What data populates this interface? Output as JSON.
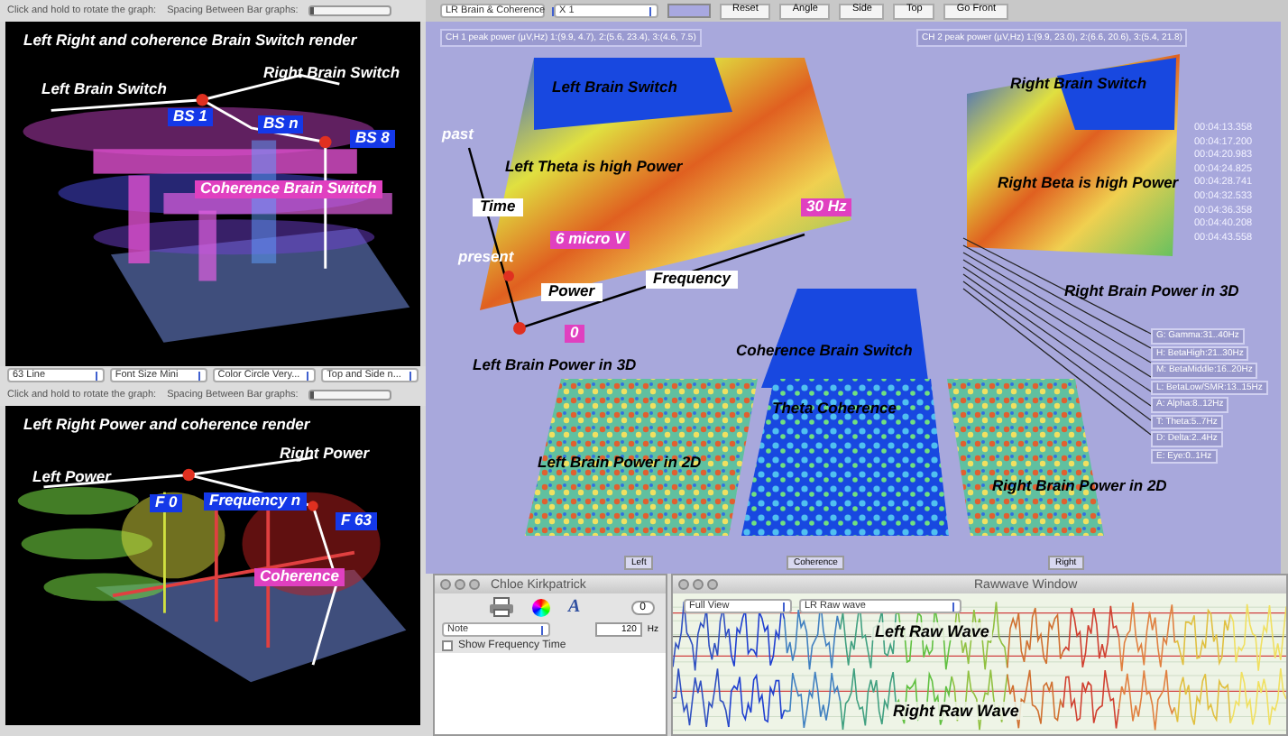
{
  "left_panels": [
    {
      "hint": "Click and hold to rotate the graph:",
      "spacing_label": "Spacing Between Bar graphs:",
      "spacing": {
        "level": 0.04
      },
      "title": "Left Right and coherence Brain Switch render",
      "annotations": [
        {
          "text": "Left Brain Switch",
          "kind": "caption"
        },
        {
          "text": "Right Brain Switch",
          "kind": "caption"
        },
        {
          "text": "BS 1",
          "kind": "tag"
        },
        {
          "text": "BS n",
          "kind": "tag"
        },
        {
          "text": "BS 8",
          "kind": "tag"
        },
        {
          "text": "Coherence Brain Switch",
          "kind": "pink"
        }
      ],
      "selects": [
        "63 Line",
        "Font Size Mini",
        "Color Circle Very...",
        "Top and Side n..."
      ]
    },
    {
      "hint": "Click and hold to rotate the graph:",
      "spacing_label": "Spacing Between Bar graphs:",
      "spacing": {
        "level": 0.04
      },
      "title": "Left Right Power and coherence render",
      "annotations": [
        {
          "text": "Right Power",
          "kind": "caption"
        },
        {
          "text": "Left Power",
          "kind": "caption"
        },
        {
          "text": "F 0",
          "kind": "tag"
        },
        {
          "text": "Frequency n",
          "kind": "tag"
        },
        {
          "text": "F 63",
          "kind": "tag"
        },
        {
          "text": "Coherence",
          "kind": "pink"
        }
      ]
    }
  ],
  "main": {
    "selects": [
      "LR Brain & Coherence",
      "X 1"
    ],
    "buttons": [
      "Reset",
      "Angle",
      "Side",
      "Top",
      "Go Front"
    ],
    "headers": [
      "CH 1 peak power (µV,Hz) 1:(9.9, 4.7), 2:(5.6, 23.4), 3:(4.6, 7.5)",
      "CH 2 peak power (µV,Hz) 1:(9.9, 23.0), 2:(6.6, 20.6), 3:(5.4, 21.8)"
    ],
    "annotations": [
      {
        "text": "Left Brain Switch",
        "kind": "note"
      },
      {
        "text": "Right Brain Switch",
        "kind": "note"
      },
      {
        "text": "past",
        "kind": "caption"
      },
      {
        "text": "Left Theta is high Power",
        "kind": "note"
      },
      {
        "text": "Right Beta is high Power",
        "kind": "note"
      },
      {
        "text": "Time",
        "kind": "box"
      },
      {
        "text": "30 Hz",
        "kind": "pink"
      },
      {
        "text": "6 micro V",
        "kind": "pink"
      },
      {
        "text": "present",
        "kind": "caption"
      },
      {
        "text": "Power",
        "kind": "box"
      },
      {
        "text": "Frequency",
        "kind": "box"
      },
      {
        "text": "Right Brain Power in 3D",
        "kind": "note"
      },
      {
        "text": "0",
        "kind": "pink"
      },
      {
        "text": "Coherence Brain Switch",
        "kind": "note"
      },
      {
        "text": "Left Brain Power in 3D",
        "kind": "note"
      },
      {
        "text": "Theta Coherence",
        "kind": "note"
      },
      {
        "text": "Left Brain Power in 2D",
        "kind": "note"
      },
      {
        "text": "Right Brain Power in 2D",
        "kind": "note"
      }
    ],
    "timestamps": [
      "00:04:13.358",
      "00:04:17.200",
      "00:04:20.983",
      "00:04:24.825",
      "00:04:28.741",
      "00:04:32.533",
      "00:04:36.358",
      "00:04:40.208",
      "00:04:43.558"
    ],
    "legend": [
      "G: Gamma:31..40Hz",
      "H: BetaHigh:21..30Hz",
      "M: BetaMiddle:16..20Hz",
      "L: BetaLow/SMR:13..15Hz",
      "A: Alpha:8..12Hz",
      "T: Theta:5..7Hz",
      "D: Delta:2..4Hz",
      "E: Eye:0..1Hz"
    ],
    "views": [
      "Left",
      "Coherence",
      "Right"
    ]
  },
  "notes_window": {
    "title": "Chloe Kirkpatrick",
    "font_button": "A",
    "counter": "0",
    "select": "Note",
    "value": "120",
    "unit": "Hz",
    "checkbox": {
      "label": "Show Frequency Time",
      "checked": false
    }
  },
  "rawwave_window": {
    "title": "Rawwave Window",
    "selects": [
      "Full View",
      "LR Raw wave"
    ],
    "labels": [
      "Left Raw Wave",
      "Right Raw Wave"
    ]
  }
}
